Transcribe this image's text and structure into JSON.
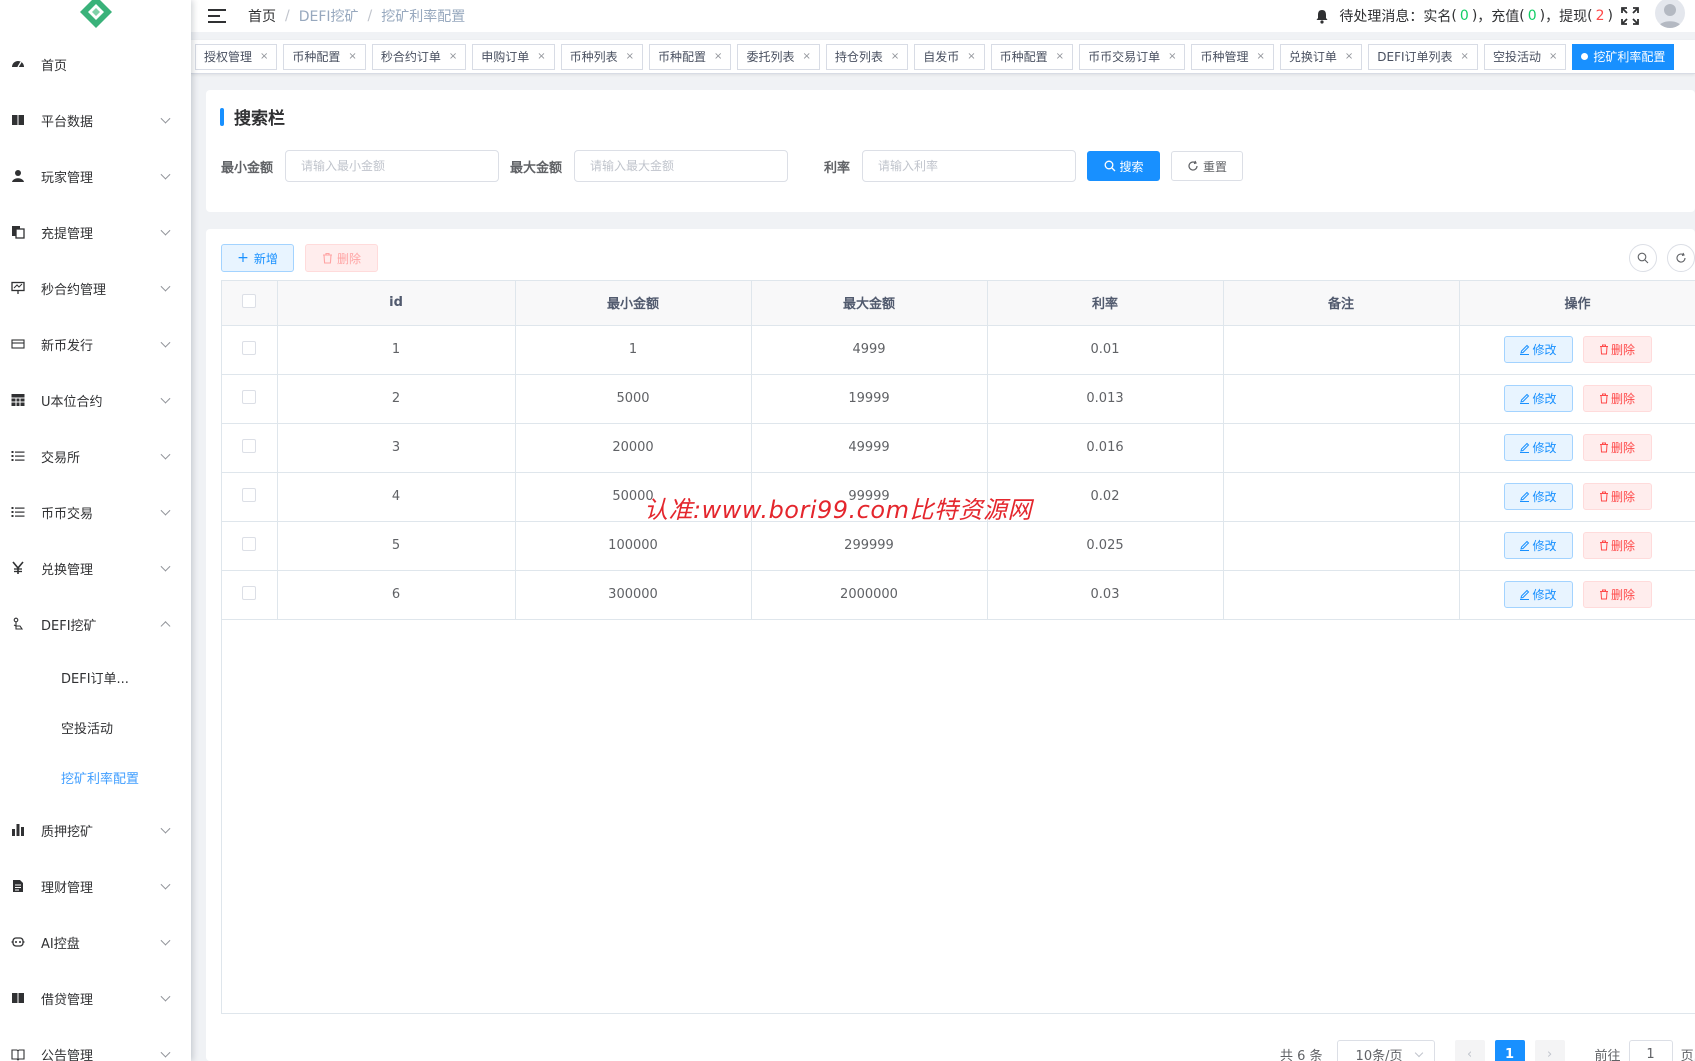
{
  "sidebar": {
    "items": [
      {
        "label": "首页",
        "icon": "dashboard-icon",
        "arrow": false
      },
      {
        "label": "平台数据",
        "icon": "book-icon",
        "arrow": true
      },
      {
        "label": "玩家管理",
        "icon": "user-icon",
        "arrow": true
      },
      {
        "label": "充提管理",
        "icon": "copy-icon",
        "arrow": true
      },
      {
        "label": "秒合约管理",
        "icon": "monitor-icon",
        "arrow": true
      },
      {
        "label": "新币发行",
        "icon": "card-icon",
        "arrow": true
      },
      {
        "label": "U本位合约",
        "icon": "table-icon",
        "arrow": true
      },
      {
        "label": "交易所",
        "icon": "list-icon",
        "arrow": true
      },
      {
        "label": "币币交易",
        "icon": "list-icon",
        "arrow": true
      },
      {
        "label": "兑换管理",
        "icon": "yen-icon",
        "arrow": true
      },
      {
        "label": "DEFI挖矿",
        "icon": "hand-icon",
        "arrow": true,
        "open": true
      }
    ],
    "sub_items": [
      "DEFI订单...",
      "空投活动",
      "挖矿利率配置"
    ],
    "items_after": [
      {
        "label": "质押挖矿",
        "icon": "bar-chart-icon"
      },
      {
        "label": "理财管理",
        "icon": "document-icon"
      },
      {
        "label": "AI控盘",
        "icon": "robot-icon"
      },
      {
        "label": "借贷管理",
        "icon": "book-icon"
      },
      {
        "label": "公告管理",
        "icon": "book-open-icon"
      }
    ]
  },
  "navbar": {
    "breadcrumb": [
      "首页",
      "DEFI挖矿",
      "挖矿利率配置"
    ],
    "pending_label": "待处理消息：实名",
    "realname_count": "0",
    "recharge_label": "，充值",
    "recharge_count": "0",
    "withdraw_label": "，提现",
    "withdraw_count": "2",
    "lparen": "(",
    "rparen": ")"
  },
  "tags": [
    "授权管理",
    "币种配置",
    "秒合约订单",
    "申购订单",
    "币种列表",
    "币种配置",
    "委托列表",
    "持仓列表",
    "自发币",
    "币种配置",
    "币币交易订单",
    "币种管理",
    "兑换订单",
    "DEFI订单列表",
    "空投活动"
  ],
  "active_tag": "挖矿利率配置",
  "search": {
    "title": "搜索栏",
    "min_label": "最小金额",
    "min_placeholder": "请输入最小金额",
    "max_label": "最大金额",
    "max_placeholder": "请输入最大金额",
    "rate_label": "利率",
    "rate_placeholder": "请输入利率",
    "search_btn": "搜索",
    "reset_btn": "重置"
  },
  "toolbar": {
    "add": "新增",
    "delete": "删除"
  },
  "table": {
    "headers": [
      "id",
      "最小金额",
      "最大金额",
      "利率",
      "备注",
      "操作"
    ],
    "rows": [
      {
        "id": "1",
        "min": "1",
        "max": "4999",
        "rate": "0.01",
        "remark": ""
      },
      {
        "id": "2",
        "min": "5000",
        "max": "19999",
        "rate": "0.013",
        "remark": ""
      },
      {
        "id": "3",
        "min": "20000",
        "max": "49999",
        "rate": "0.016",
        "remark": ""
      },
      {
        "id": "4",
        "min": "50000",
        "max": "99999",
        "rate": "0.02",
        "remark": ""
      },
      {
        "id": "5",
        "min": "100000",
        "max": "299999",
        "rate": "0.025",
        "remark": ""
      },
      {
        "id": "6",
        "min": "300000",
        "max": "2000000",
        "rate": "0.03",
        "remark": ""
      }
    ],
    "edit_label": "修改",
    "delete_label": "删除"
  },
  "pagination": {
    "total": "共 6 条",
    "page_size": "10条/页",
    "current": "1",
    "goto_label": "前往",
    "goto_value": "1",
    "page_suffix": "页"
  },
  "watermark": "认准:www.bori99.com比特资源网",
  "colors": {
    "primary": "#1890ff",
    "danger": "#ff4949",
    "success": "#13ce66"
  }
}
